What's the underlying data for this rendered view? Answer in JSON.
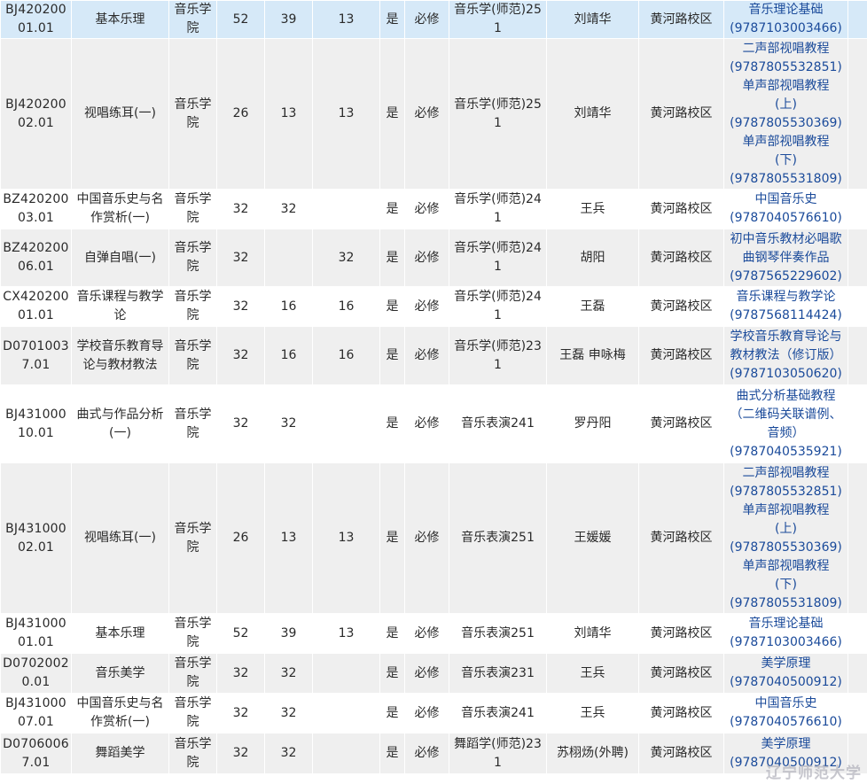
{
  "rows": [
    {
      "code": "BJ42020001.01",
      "name": "基本乐理",
      "college": "音乐学院",
      "hours": "52",
      "h1": "39",
      "h2": "13",
      "h3": "",
      "flag": "是",
      "type": "必修",
      "klass": "音乐学(师范)251",
      "teacher": "刘靖华",
      "campus": "黄河路校区",
      "books": [
        "音乐理论基础",
        "(9787103003466)"
      ]
    },
    {
      "code": "BJ42020002.01",
      "name": "视唱练耳(一)",
      "college": "音乐学院",
      "hours": "26",
      "h1": "13",
      "h2": "13",
      "h3": "",
      "flag": "是",
      "type": "必修",
      "klass": "音乐学(师范)251",
      "teacher": "刘靖华",
      "campus": "黄河路校区",
      "books": [
        "二声部视唱教程",
        "(9787805532851)",
        "单声部视唱教程",
        "(上)",
        "(9787805530369)",
        "单声部视唱教程",
        "(下)",
        "(9787805531809)"
      ]
    },
    {
      "code": "BZ42020003.01",
      "name": "中国音乐史与名作赏析(一)",
      "college": "音乐学院",
      "hours": "32",
      "h1": "32",
      "h2": "",
      "h3": "",
      "flag": "是",
      "type": "必修",
      "klass": "音乐学(师范)241",
      "teacher": "王兵",
      "campus": "黄河路校区",
      "books": [
        "中国音乐史",
        "(9787040576610)"
      ]
    },
    {
      "code": "BZ42020006.01",
      "name": "自弹自唱(一)",
      "college": "音乐学院",
      "hours": "32",
      "h1": "",
      "h2": "32",
      "h3": "",
      "flag": "是",
      "type": "必修",
      "klass": "音乐学(师范)241",
      "teacher": "胡阳",
      "campus": "黄河路校区",
      "books": [
        "初中音乐教材必唱歌",
        "曲钢琴伴奏作品",
        "(9787565229602)"
      ]
    },
    {
      "code": "CX42020001.01",
      "name": "音乐课程与教学论",
      "college": "音乐学院",
      "hours": "32",
      "h1": "16",
      "h2": "16",
      "h3": "",
      "flag": "是",
      "type": "必修",
      "klass": "音乐学(师范)241",
      "teacher": "王磊",
      "campus": "黄河路校区",
      "books": [
        "音乐课程与教学论",
        "(9787568114424)"
      ]
    },
    {
      "code": "D07010037.01",
      "name": "学校音乐教育导论与教材教法",
      "college": "音乐学院",
      "hours": "32",
      "h1": "16",
      "h2": "16",
      "h3": "",
      "flag": "是",
      "type": "必修",
      "klass": "音乐学(师范)231",
      "teacher": "王磊 申咏梅",
      "campus": "黄河路校区",
      "books": [
        "学校音乐教育导论与",
        "教材教法（修订版）",
        "(9787103050620)"
      ]
    },
    {
      "code": "BJ43100010.01",
      "name": "曲式与作品分析(一)",
      "college": "音乐学院",
      "hours": "32",
      "h1": "32",
      "h2": "",
      "h3": "",
      "flag": "是",
      "type": "必修",
      "klass": "音乐表演241",
      "teacher": "罗丹阳",
      "campus": "黄河路校区",
      "books": [
        "曲式分析基础教程",
        "（二维码关联谱例、",
        "音频）",
        "(9787040535921)"
      ]
    },
    {
      "code": "BJ43100002.01",
      "name": "视唱练耳(一)",
      "college": "音乐学院",
      "hours": "26",
      "h1": "13",
      "h2": "13",
      "h3": "",
      "flag": "是",
      "type": "必修",
      "klass": "音乐表演251",
      "teacher": "王媛媛",
      "campus": "黄河路校区",
      "books": [
        "二声部视唱教程",
        "(9787805532851)",
        "单声部视唱教程",
        "(上)",
        "(9787805530369)",
        "单声部视唱教程",
        "(下)",
        "(9787805531809)"
      ]
    },
    {
      "code": "BJ43100001.01",
      "name": "基本乐理",
      "college": "音乐学院",
      "hours": "52",
      "h1": "39",
      "h2": "13",
      "h3": "",
      "flag": "是",
      "type": "必修",
      "klass": "音乐表演251",
      "teacher": "刘靖华",
      "campus": "黄河路校区",
      "books": [
        "音乐理论基础",
        "(9787103003466)"
      ]
    },
    {
      "code": "D07020020.01",
      "name": "音乐美学",
      "college": "音乐学院",
      "hours": "32",
      "h1": "32",
      "h2": "",
      "h3": "",
      "flag": "是",
      "type": "必修",
      "klass": "音乐表演231",
      "teacher": "王兵",
      "campus": "黄河路校区",
      "books": [
        "美学原理",
        "(9787040500912)"
      ]
    },
    {
      "code": "BJ43100007.01",
      "name": "中国音乐史与名作赏析(一)",
      "college": "音乐学院",
      "hours": "32",
      "h1": "32",
      "h2": "",
      "h3": "",
      "flag": "是",
      "type": "必修",
      "klass": "音乐表演241",
      "teacher": "王兵",
      "campus": "黄河路校区",
      "books": [
        "中国音乐史",
        "(9787040576610)"
      ]
    },
    {
      "code": "D07060067.01",
      "name": "舞蹈美学",
      "college": "音乐学院",
      "hours": "32",
      "h1": "32",
      "h2": "",
      "h3": "",
      "flag": "是",
      "type": "必修",
      "klass": "舞蹈学(师范)231",
      "teacher": "苏栩炀(外聘)",
      "campus": "黄河路校区",
      "books": [
        "美学原理",
        "(9787040500912)"
      ]
    }
  ],
  "watermark": "辽宁师范大学"
}
